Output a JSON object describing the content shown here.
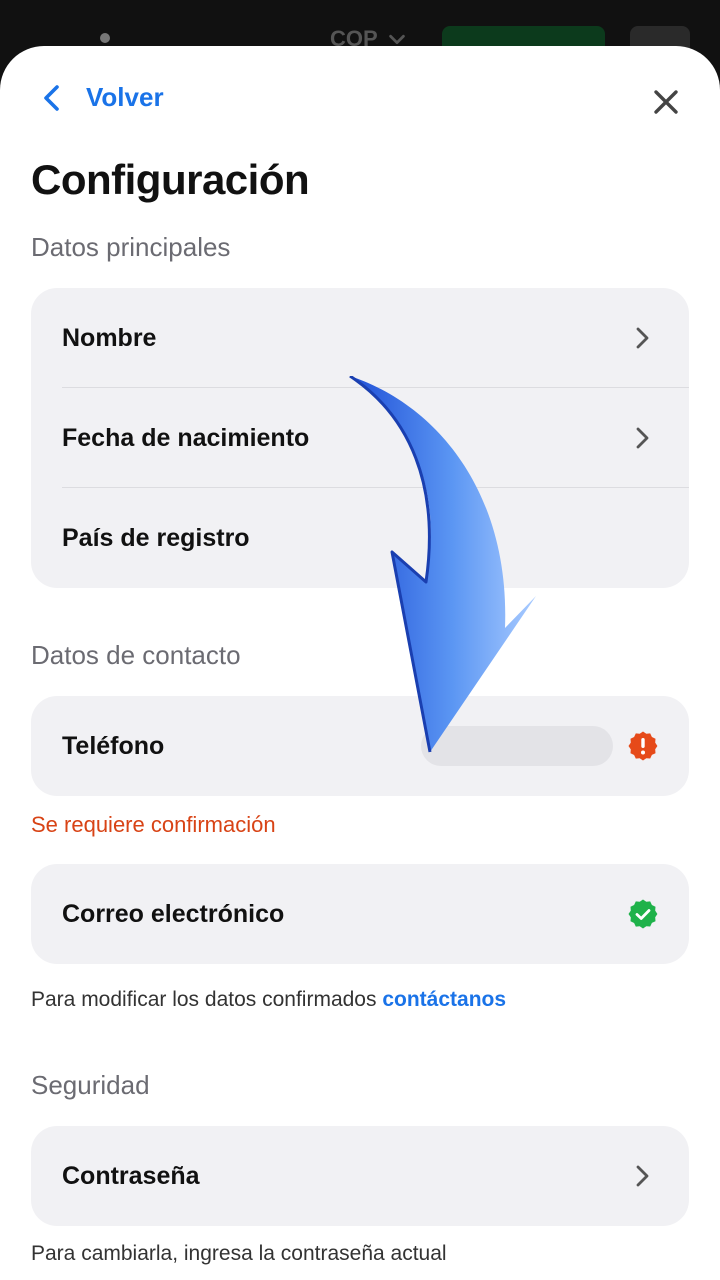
{
  "background": {
    "currency": "COP"
  },
  "header": {
    "back_label": "Volver",
    "title": "Configuración"
  },
  "sections": {
    "main": "Datos principales",
    "contact": "Datos de contacto",
    "security": "Seguridad"
  },
  "main_data": {
    "items": [
      {
        "label": "Nombre",
        "has_chevron": true
      },
      {
        "label": "Fecha de nacimiento",
        "has_chevron": true
      },
      {
        "label": "País de registro",
        "has_chevron": false
      }
    ]
  },
  "contact": {
    "phone_label": "Teléfono",
    "phone_status": "warning",
    "phone_warning": "Se requiere confirmación",
    "email_label": "Correo electrónico",
    "email_status": "verified",
    "note_text": "Para modificar los datos confirmados",
    "note_link": "contáctanos"
  },
  "security": {
    "password_label": "Contraseña",
    "note": "Para cambiarla, ingresa la contraseña actual"
  },
  "colors": {
    "accent": "#1a73e8",
    "warning": "#e64a19",
    "success": "#1fb24a",
    "card": "#f1f1f4"
  }
}
